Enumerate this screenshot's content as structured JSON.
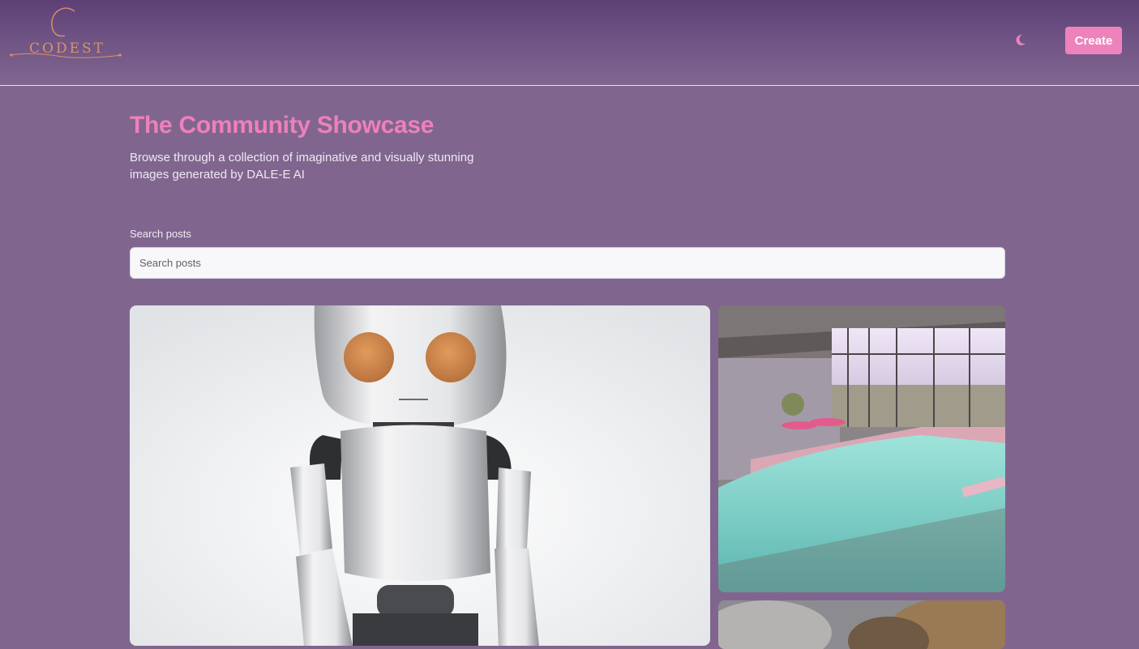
{
  "header": {
    "logo_text": "CODEST",
    "theme_icon": "moon-icon",
    "create_label": "Create"
  },
  "main": {
    "title": "The Community Showcase",
    "subtitle": "Browse through a collection of imaginative and visually stunning images generated by DALE-E AI"
  },
  "search": {
    "label": "Search posts",
    "placeholder": "Search posts",
    "value": ""
  },
  "colors": {
    "accent": "#ee83bb",
    "background": "#80668f",
    "header_top": "#5d3f75"
  }
}
